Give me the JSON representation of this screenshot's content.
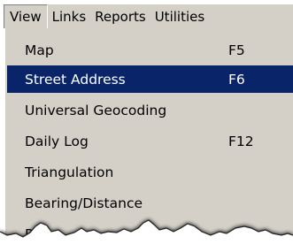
{
  "menubar": {
    "items": [
      {
        "label": "View",
        "open": true
      },
      {
        "label": "Links",
        "open": false
      },
      {
        "label": "Reports",
        "open": false
      },
      {
        "label": "Utilities",
        "open": false
      }
    ]
  },
  "dropdown": {
    "items": [
      {
        "label": "Map",
        "shortcut": "F5",
        "selected": false
      },
      {
        "label": "Street Address",
        "shortcut": "F6",
        "selected": true
      },
      {
        "label": "Universal Geocoding",
        "shortcut": "",
        "selected": false
      },
      {
        "label": "Daily Log",
        "shortcut": "F12",
        "selected": false
      },
      {
        "label": "Triangulation",
        "shortcut": "",
        "selected": false
      },
      {
        "label": "Bearing/Distance",
        "shortcut": "",
        "selected": false
      },
      {
        "label": "P",
        "shortcut": "",
        "selected": false
      }
    ]
  },
  "colors": {
    "menu_background": "#d4d0c8",
    "selection_background": "#0a246a",
    "selection_text": "#ffffff",
    "text": "#000000"
  }
}
